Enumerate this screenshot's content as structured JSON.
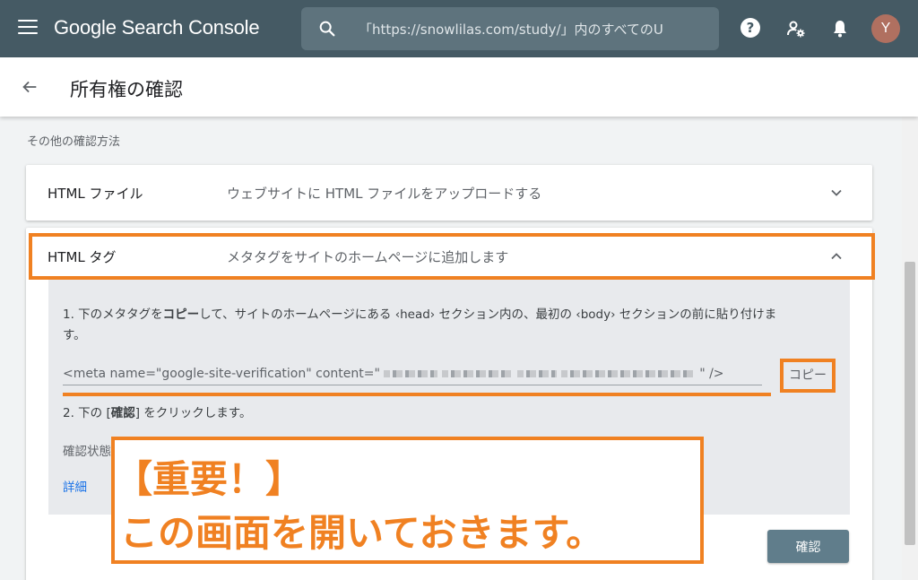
{
  "topbar": {
    "app_title": "Google Search Console",
    "search_placeholder": "「https://snowlilas.com/study/」内のすべてのU",
    "avatar_letter": "Y",
    "bg_color": "#455a64"
  },
  "subheader": {
    "title": "所有権の確認"
  },
  "content": {
    "section_label": "その他の確認方法",
    "methods": [
      {
        "name": "HTML ファイル",
        "desc": "ウェブサイトに HTML ファイルをアップロードする"
      },
      {
        "name": "HTML タグ",
        "desc": "メタタグをサイトのホームページに追加します"
      }
    ],
    "step1_a": "1. 下のメタタグを",
    "step1_bold": "コピー",
    "step1_b": "して、サイトのホームページにある ‹head› セクション内の、最初の ‹body› セクションの前に貼り付けま",
    "step1_c": "す。",
    "meta_prefix": "<meta name=\"google-site-verification\" content=\"",
    "meta_suffix": "\" />",
    "copy_label": "コピー",
    "step2_a": "2. 下の [",
    "step2_bold": "確認",
    "step2_b": "] をクリックします。",
    "status_label": "確認状態",
    "detail_link": "詳細",
    "confirm_label": "確認"
  },
  "annotation": {
    "line1": "【重要！】",
    "line2": "この画面を開いておきます。",
    "color": "#f08122"
  }
}
